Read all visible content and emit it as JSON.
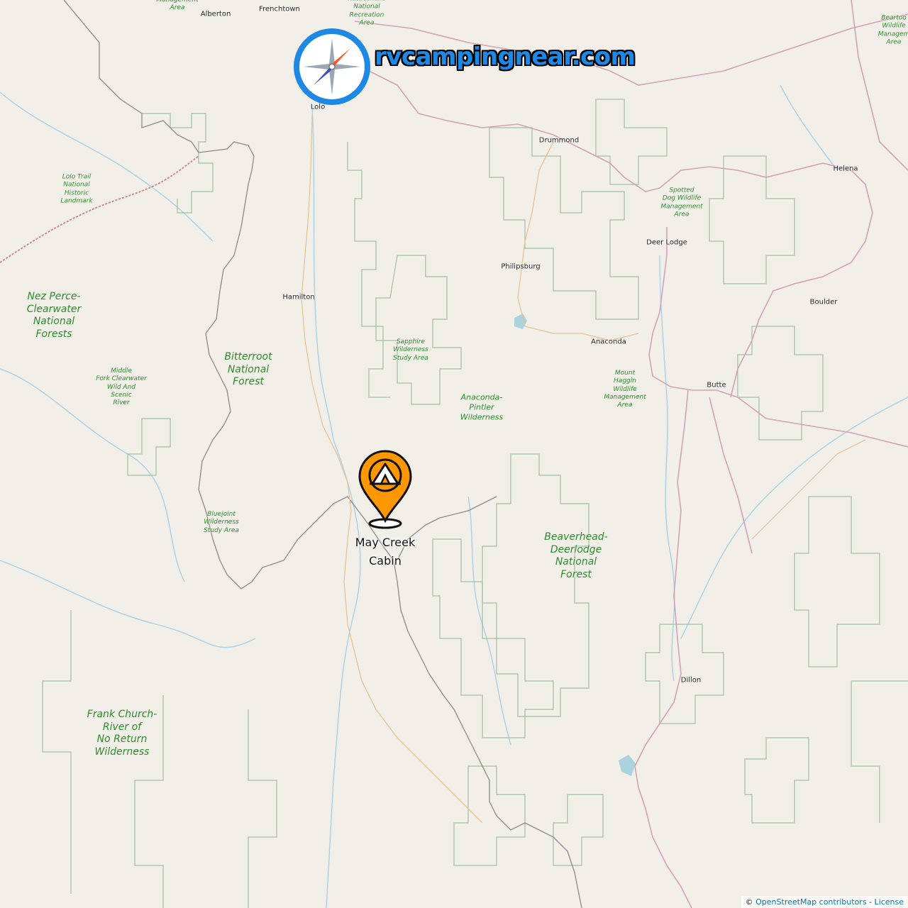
{
  "site": {
    "brand": "rvcampingnear.com"
  },
  "marker": {
    "name": "May Creek Cabin",
    "icon": "tent-pin-icon",
    "color": "#ff9800"
  },
  "towns": [
    {
      "id": "alberton",
      "name": "Alberton"
    },
    {
      "id": "frenchtown",
      "name": "Frenchtown"
    },
    {
      "id": "lolo",
      "name": "Lolo"
    },
    {
      "id": "drummond",
      "name": "Drummond"
    },
    {
      "id": "helena",
      "name": "Helena"
    },
    {
      "id": "deer-lodge",
      "name": "Deer Lodge"
    },
    {
      "id": "philipsburg",
      "name": "Philipsburg"
    },
    {
      "id": "hamilton",
      "name": "Hamilton"
    },
    {
      "id": "anaconda",
      "name": "Anaconda"
    },
    {
      "id": "boulder",
      "name": "Boulder"
    },
    {
      "id": "butte",
      "name": "Butte"
    },
    {
      "id": "dillon",
      "name": "Dillon"
    }
  ],
  "areas": [
    {
      "id": "nez-perce",
      "name": "Nez Perce-\nClearwater\nNational\nForests"
    },
    {
      "id": "bitterroot",
      "name": "Bitterroot\nNational\nForest"
    },
    {
      "id": "beaverhead",
      "name": "Beaverhead-\nDeerlodge\nNational\nForest"
    },
    {
      "id": "frank-church",
      "name": "Frank Church-\nRiver of\nNo Return\nWilderness"
    },
    {
      "id": "anaconda-pintler",
      "name": "Anaconda-\nPintler\nWilderness"
    },
    {
      "id": "lolo-trail",
      "name": "Lolo Trail\nNational\nHistoric\nLandmark"
    },
    {
      "id": "middle-fork",
      "name": "Middle\nFork Clearwater\nWild And\nScenic\nRiver"
    },
    {
      "id": "sapphire",
      "name": "Sapphire\nWilderness\nStudy Area"
    },
    {
      "id": "bluejoint",
      "name": "Bluejoint\nWilderness\nStudy Area"
    },
    {
      "id": "spotted-dog",
      "name": "Spotted\nDog Wildlife\nManagement\nArea"
    },
    {
      "id": "mount-haggin",
      "name": "Mount\nHaggin\nWildlife\nManagement\nArea"
    },
    {
      "id": "rattlesnake",
      "name": "Rattlesnake\nNational\nRecreation\nArea"
    },
    {
      "id": "beartooth",
      "name": "Beartoo\nWildlife\nManagem\nArea"
    },
    {
      "id": "wma-top",
      "name": "Management\nArea"
    }
  ],
  "attribution": {
    "prefix": "© ",
    "link": "OpenStreetMap contributors",
    "separator": " - ",
    "license": "License"
  },
  "colors": {
    "background": "#f2efe9",
    "forest_boundary": "#9fbf9f",
    "wilderness_boundary": "#888888",
    "highway": "#e8a0b0",
    "river": "#a8d0e6",
    "forest_label": "#2e8b2e",
    "brand": "#1e88e5"
  }
}
